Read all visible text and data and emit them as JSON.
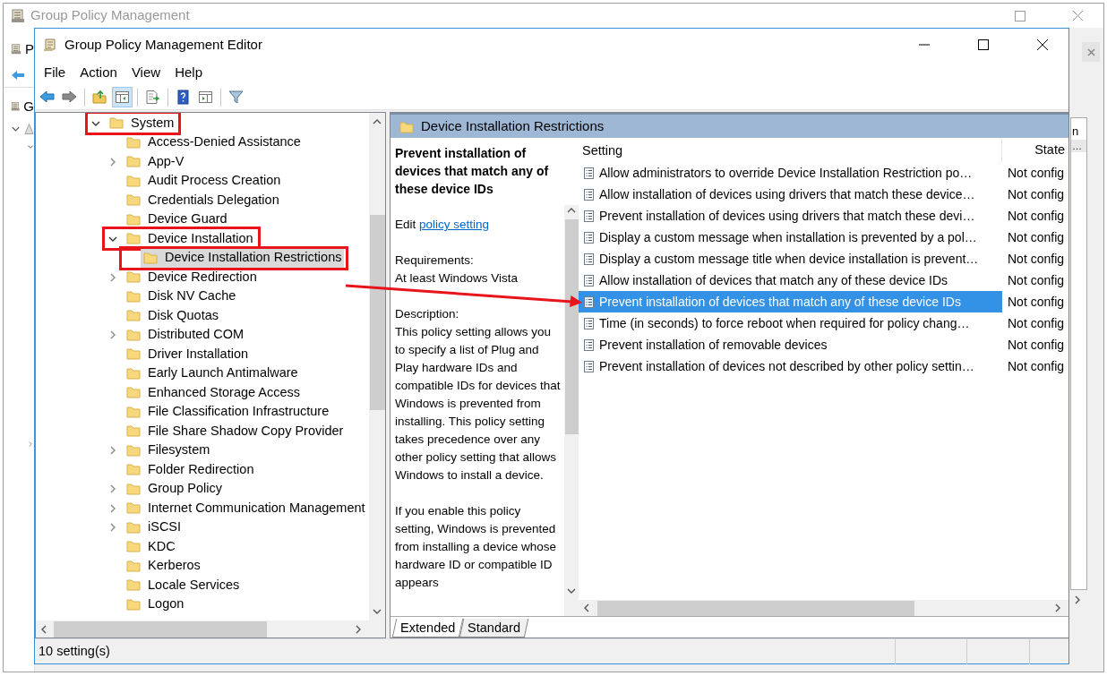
{
  "back_window": {
    "title": "Group Policy Management",
    "child_title_fragment": "P",
    "tree_fragment": "G",
    "column_fragment": "n",
    "cell_fragment": "…"
  },
  "window": {
    "title": "Group Policy Management Editor"
  },
  "menu": [
    "File",
    "Action",
    "View",
    "Help"
  ],
  "toolbar": [
    {
      "kind": "back",
      "pressed": false
    },
    {
      "kind": "forward",
      "pressed": false
    },
    {
      "kind": "separator"
    },
    {
      "kind": "up",
      "pressed": false
    },
    {
      "kind": "tree",
      "pressed": true
    },
    {
      "kind": "separator"
    },
    {
      "kind": "export",
      "pressed": false
    },
    {
      "kind": "separator"
    },
    {
      "kind": "help",
      "pressed": false
    },
    {
      "kind": "action-pane",
      "pressed": false
    },
    {
      "kind": "separator"
    },
    {
      "kind": "filter",
      "pressed": false
    }
  ],
  "tree": [
    {
      "label": "System",
      "expandable": true,
      "expanded": true,
      "selected": false,
      "highlighted": true,
      "children": [
        {
          "label": "Access-Denied Assistance",
          "expandable": false,
          "expanded": false,
          "selected": false,
          "highlighted": false
        },
        {
          "label": "App-V",
          "expandable": true,
          "expanded": false,
          "selected": false,
          "highlighted": false
        },
        {
          "label": "Audit Process Creation",
          "expandable": false,
          "expanded": false,
          "selected": false,
          "highlighted": false
        },
        {
          "label": "Credentials Delegation",
          "expandable": false,
          "expanded": false,
          "selected": false,
          "highlighted": false
        },
        {
          "label": "Device Guard",
          "expandable": false,
          "expanded": false,
          "selected": false,
          "highlighted": false
        },
        {
          "label": "Device Installation",
          "expandable": true,
          "expanded": true,
          "selected": false,
          "highlighted": true,
          "children": [
            {
              "label": "Device Installation Restrictions",
              "expandable": false,
              "expanded": false,
              "selected": true,
              "highlighted": true
            }
          ]
        },
        {
          "label": "Device Redirection",
          "expandable": true,
          "expanded": false,
          "selected": false,
          "highlighted": false
        },
        {
          "label": "Disk NV Cache",
          "expandable": false,
          "expanded": false,
          "selected": false,
          "highlighted": false
        },
        {
          "label": "Disk Quotas",
          "expandable": false,
          "expanded": false,
          "selected": false,
          "highlighted": false
        },
        {
          "label": "Distributed COM",
          "expandable": true,
          "expanded": false,
          "selected": false,
          "highlighted": false
        },
        {
          "label": "Driver Installation",
          "expandable": false,
          "expanded": false,
          "selected": false,
          "highlighted": false
        },
        {
          "label": "Early Launch Antimalware",
          "expandable": false,
          "expanded": false,
          "selected": false,
          "highlighted": false
        },
        {
          "label": "Enhanced Storage Access",
          "expandable": false,
          "expanded": false,
          "selected": false,
          "highlighted": false
        },
        {
          "label": "File Classification Infrastructure",
          "expandable": false,
          "expanded": false,
          "selected": false,
          "highlighted": false
        },
        {
          "label": "File Share Shadow Copy Provider",
          "expandable": false,
          "expanded": false,
          "selected": false,
          "highlighted": false
        },
        {
          "label": "Filesystem",
          "expandable": true,
          "expanded": false,
          "selected": false,
          "highlighted": false
        },
        {
          "label": "Folder Redirection",
          "expandable": false,
          "expanded": false,
          "selected": false,
          "highlighted": false
        },
        {
          "label": "Group Policy",
          "expandable": true,
          "expanded": false,
          "selected": false,
          "highlighted": false
        },
        {
          "label": "Internet Communication Management",
          "expandable": true,
          "expanded": false,
          "selected": false,
          "highlighted": false
        },
        {
          "label": "iSCSI",
          "expandable": true,
          "expanded": false,
          "selected": false,
          "highlighted": false
        },
        {
          "label": "KDC",
          "expandable": false,
          "expanded": false,
          "selected": false,
          "highlighted": false
        },
        {
          "label": "Kerberos",
          "expandable": false,
          "expanded": false,
          "selected": false,
          "highlighted": false
        },
        {
          "label": "Locale Services",
          "expandable": false,
          "expanded": false,
          "selected": false,
          "highlighted": false
        },
        {
          "label": "Logon",
          "expandable": false,
          "expanded": false,
          "selected": false,
          "highlighted": false
        }
      ]
    }
  ],
  "details": {
    "heading": "Device Installation Restrictions",
    "description": {
      "title": "Prevent installation of devices that match any of these device IDs",
      "edit_prefix": "Edit",
      "edit_link": "policy setting",
      "sections": [
        {
          "label": "Requirements:",
          "text": "At least Windows Vista"
        },
        {
          "label": "Description:",
          "text": "This policy setting allows you to specify a list of Plug and Play hardware IDs and compatible IDs for devices that Windows is prevented from installing. This policy setting takes precedence over any other policy setting that allows Windows to install a device."
        }
      ],
      "more": "If you enable this policy setting, Windows is prevented from installing a device whose hardware ID or compatible ID appears"
    },
    "columns": [
      "Setting",
      "State"
    ],
    "rows": [
      {
        "setting": "Allow administrators to override Device Installation Restriction po…",
        "state": "Not config",
        "selected": false
      },
      {
        "setting": "Allow installation of devices using drivers that match these device…",
        "state": "Not config",
        "selected": false
      },
      {
        "setting": "Prevent installation of devices using drivers that match these devi…",
        "state": "Not config",
        "selected": false
      },
      {
        "setting": "Display a custom message when installation is prevented by a pol…",
        "state": "Not config",
        "selected": false
      },
      {
        "setting": "Display a custom message title when device installation is prevent…",
        "state": "Not config",
        "selected": false
      },
      {
        "setting": "Allow installation of devices that match any of these device IDs",
        "state": "Not config",
        "selected": false
      },
      {
        "setting": "Prevent installation of devices that match any of these device IDs",
        "state": "Not config",
        "selected": true
      },
      {
        "setting": "Time (in seconds) to force reboot when required for policy chang…",
        "state": "Not config",
        "selected": false
      },
      {
        "setting": "Prevent installation of removable devices",
        "state": "Not config",
        "selected": false
      },
      {
        "setting": "Prevent installation of devices not described by other policy settin…",
        "state": "Not config",
        "selected": false
      }
    ],
    "tabs": [
      {
        "label": "Extended",
        "selected": true
      },
      {
        "label": "Standard",
        "selected": false
      }
    ]
  },
  "status_bar": "10 setting(s)",
  "annotation_arrow": true
}
